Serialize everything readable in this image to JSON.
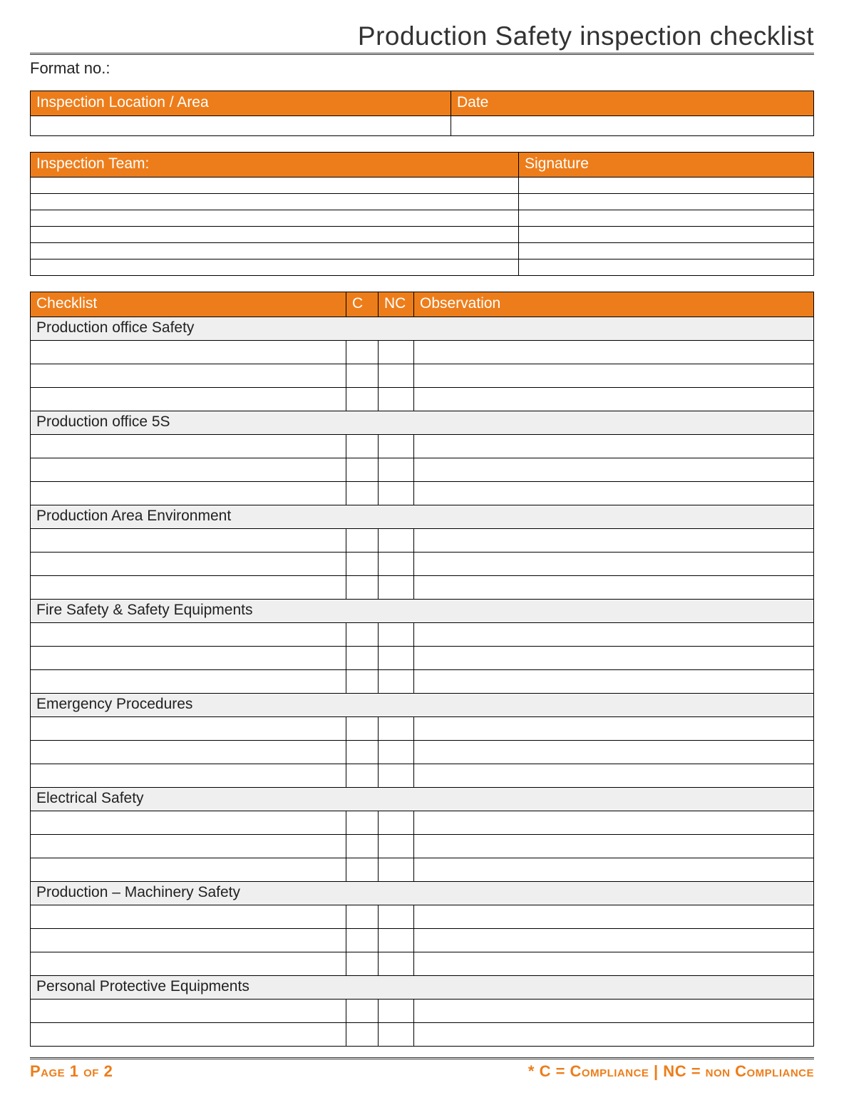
{
  "title": "Production Safety inspection checklist",
  "format_no_label": "Format no.:",
  "loc_table": {
    "location_label": "Inspection Location / Area",
    "date_label": "Date",
    "location_value": "",
    "date_value": ""
  },
  "team_table": {
    "team_label": "Inspection Team:",
    "signature_label": "Signature",
    "rows": [
      "",
      "",
      "",
      "",
      "",
      ""
    ]
  },
  "checklist": {
    "headers": {
      "item": "Checklist",
      "c": "C",
      "nc": "NC",
      "obs": "Observation"
    },
    "sections": [
      {
        "title": "Production office Safety",
        "rows": 3
      },
      {
        "title": "Production office 5S",
        "rows": 3
      },
      {
        "title": "Production Area Environment",
        "rows": 3
      },
      {
        "title": "Fire Safety & Safety Equipments",
        "rows": 3
      },
      {
        "title": "Emergency Procedures",
        "rows": 3
      },
      {
        "title": "Electrical Safety",
        "rows": 3
      },
      {
        "title": "Production – Machinery Safety",
        "rows": 3
      },
      {
        "title": "Personal Protective Equipments",
        "rows": 2
      }
    ]
  },
  "footer": {
    "page": "Page 1 of 2",
    "legend": "* C = Compliance | NC = non Compliance"
  }
}
